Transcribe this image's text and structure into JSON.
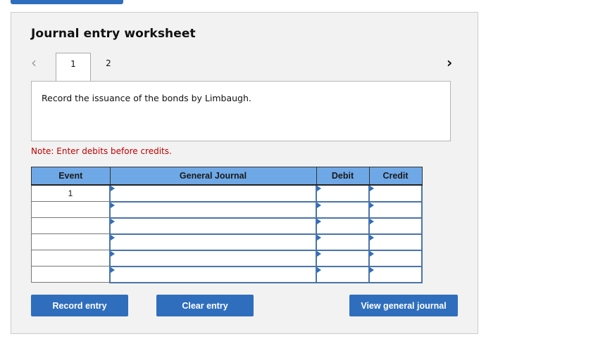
{
  "title": "Journal entry worksheet",
  "nav": {
    "prev_icon": "chevron-left-icon",
    "next_icon": "chevron-right-icon"
  },
  "tabs": [
    {
      "label": "1",
      "active": true
    },
    {
      "label": "2",
      "active": false
    }
  ],
  "prompt": "Record the issuance of the bonds by Limbaugh.",
  "note": "Note: Enter debits before credits.",
  "table": {
    "headers": [
      "Event",
      "General Journal",
      "Debit",
      "Credit"
    ],
    "rows": [
      {
        "event": "1",
        "account": "",
        "debit": "",
        "credit": ""
      },
      {
        "event": "",
        "account": "",
        "debit": "",
        "credit": ""
      },
      {
        "event": "",
        "account": "",
        "debit": "",
        "credit": ""
      },
      {
        "event": "",
        "account": "",
        "debit": "",
        "credit": ""
      },
      {
        "event": "",
        "account": "",
        "debit": "",
        "credit": ""
      },
      {
        "event": "",
        "account": "",
        "debit": "",
        "credit": ""
      }
    ]
  },
  "buttons": {
    "record": "Record entry",
    "clear": "Clear entry",
    "view": "View general journal"
  },
  "colors": {
    "accent": "#2f6ebd",
    "header": "#6fa8e6",
    "note": "#c00000"
  }
}
